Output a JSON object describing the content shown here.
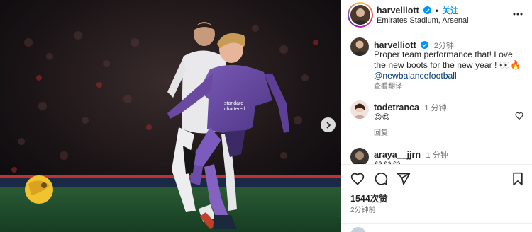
{
  "post": {
    "username": "harvelliott",
    "follow_label": "关注",
    "location": "Emirates Stadium, Arsenal",
    "separator": "•",
    "caption": {
      "username": "harvelliott",
      "time": "2分钟",
      "text": "Proper team performance that! Love the new boots for the new year ! 👀🔥",
      "mention": "@newbalancefootball",
      "translate_label": "查看翻译"
    },
    "comments": [
      {
        "username": "todetranca",
        "time": "1 分钟",
        "text": "😍😍",
        "reply_label": "回复"
      },
      {
        "username": "araya__jjrn",
        "time": "1 分钟",
        "text": "😂😂😂"
      }
    ],
    "likes": "1544次赞",
    "posted_ago": "2分钟前"
  },
  "icons": {
    "verified": "verified-badge-icon",
    "more": "more-options-icon",
    "like": "heart-icon",
    "comment": "comment-icon",
    "share": "send-icon",
    "save": "bookmark-icon",
    "next": "chevron-right-icon"
  },
  "colors": {
    "accent": "#0095f6",
    "kit_purple": "#6a4aa0",
    "pitch": "#1f4a2a"
  }
}
